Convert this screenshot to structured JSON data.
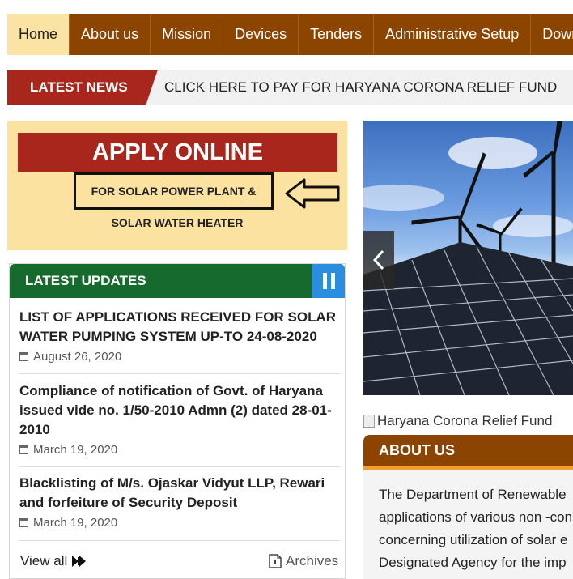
{
  "nav": {
    "items": [
      {
        "label": "Home"
      },
      {
        "label": "About us"
      },
      {
        "label": "Mission"
      },
      {
        "label": "Devices"
      },
      {
        "label": "Tenders"
      },
      {
        "label": "Administrative Setup"
      },
      {
        "label": "Downl"
      }
    ]
  },
  "news": {
    "label": "LATEST NEWS",
    "text": "CLICK HERE TO PAY FOR HARYANA CORONA RELIEF FUND"
  },
  "apply": {
    "title": "APPLY ONLINE",
    "line1": "FOR SOLAR POWER PLANT &",
    "line2": "SOLAR WATER HEATER"
  },
  "updates": {
    "title": "LATEST UPDATES",
    "items": [
      {
        "title": "LIST OF APPLICATIONS RECEIVED FOR SOLAR WATER PUMPING SYSTEM UP-TO 24-08-2020",
        "date": "August 26, 2020"
      },
      {
        "title": "Compliance of notification of Govt. of Haryana issued vide no. 1/50-2010 Admn (2) dated 28-01-2010",
        "date": "March 19, 2020"
      },
      {
        "title": "Blacklisting of M/s. Ojaskar Vidyut LLP, Rewari and forfeiture of Security Deposit",
        "date": "March 19, 2020"
      }
    ],
    "view_all": "View all",
    "archives": "Archives"
  },
  "relief": {
    "alt_text": "Haryana Corona Relief Fund"
  },
  "about": {
    "title": "ABOUT US",
    "lines": [
      "The Department of Renewable",
      "applications of various non -con",
      "concerning utilization of solar e",
      "Designated Agency for the imp"
    ]
  },
  "colors": {
    "nav_bg": "#8b4500",
    "nav_active": "#fbe3a3",
    "news_label": "#a8261b",
    "apply_bg": "#fbe2a0",
    "updates_head": "#176a2e",
    "pause_button": "#2a8de0",
    "about_accent": "#f0a030"
  }
}
